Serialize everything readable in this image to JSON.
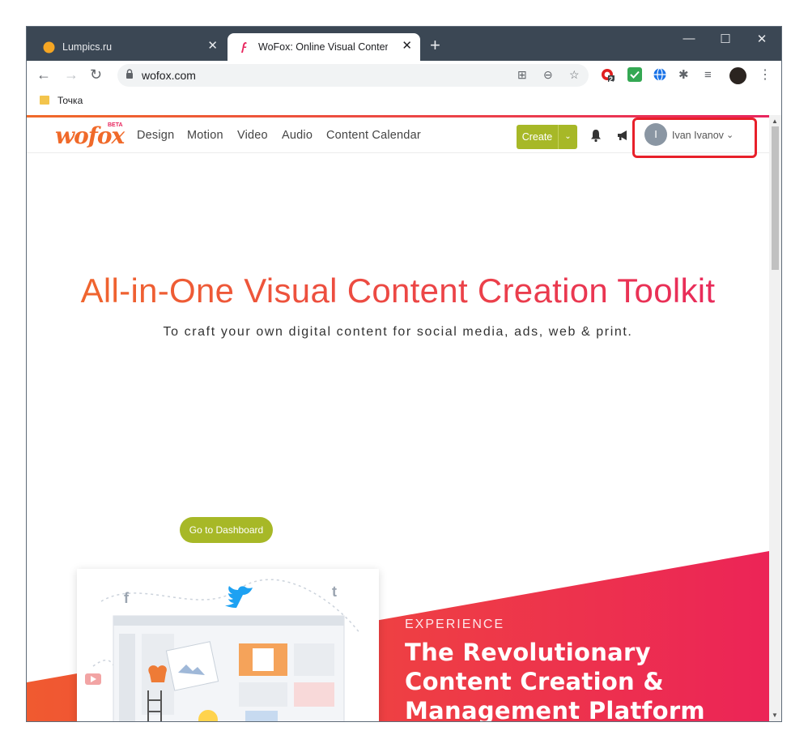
{
  "browser": {
    "tabs": [
      {
        "title": "Lumpics.ru",
        "active": false
      },
      {
        "title": "WoFox: Online Visual Content Cr",
        "active": true
      }
    ],
    "new_tab": "+",
    "address": "wofox.com",
    "bookmarks": [
      {
        "label": "Точка"
      }
    ],
    "extension_badge": "2"
  },
  "site": {
    "logo": "wofox",
    "logo_badge": "BETA",
    "nav": [
      "Design",
      "Motion",
      "Video",
      "Audio",
      "Content Calendar"
    ],
    "create_label": "Create",
    "user": {
      "initial": "I",
      "name": "Ivan Ivanov"
    }
  },
  "hero": {
    "title": "All-in-One Visual Content Creation Toolkit",
    "subtitle": "To craft your own digital content for social media, ads, web & print.",
    "cta": "Go to Dashboard"
  },
  "experience": {
    "kicker": "EXPERIENCE",
    "lines": [
      "The Revolutionary",
      "Content Creation &",
      "Management Platform"
    ]
  },
  "colors": {
    "brand_orange": "#f06a2a",
    "brand_pink": "#e8265e",
    "accent_green": "#a7b827",
    "highlight_red": "#e8202a"
  }
}
